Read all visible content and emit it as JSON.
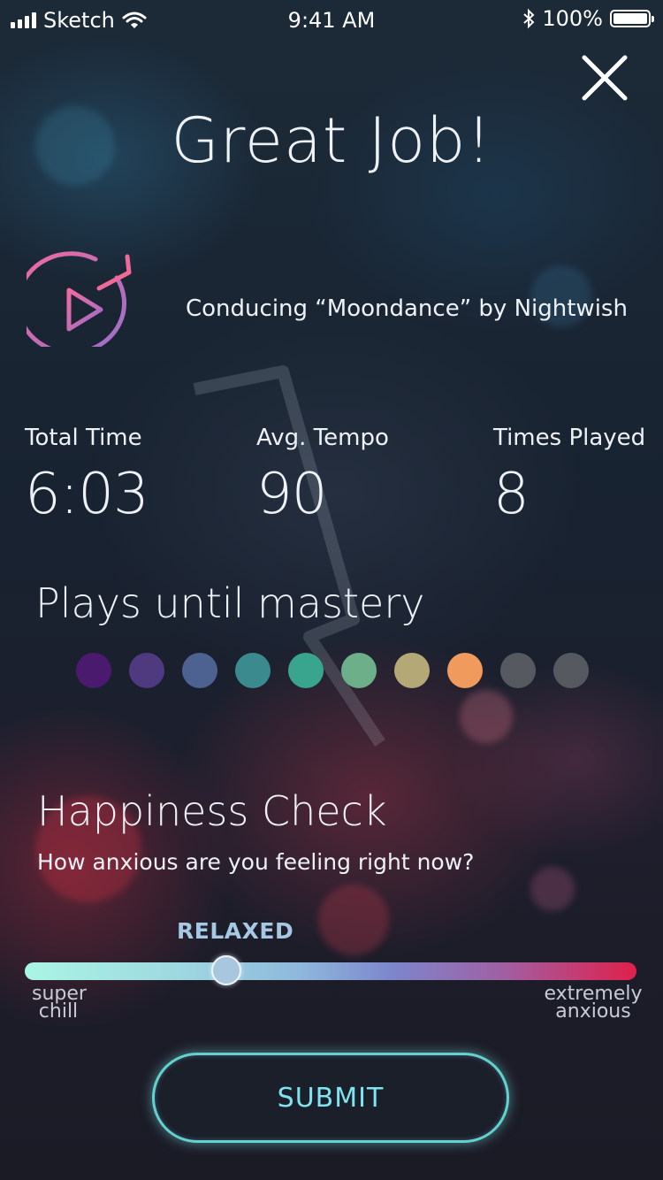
{
  "status_bar": {
    "carrier": "Sketch",
    "time": "9:41 AM",
    "battery": "100%"
  },
  "title": "Great Job!",
  "song": {
    "description": "Conducing “Moondance” by Nightwish",
    "icon": "replay-play-icon"
  },
  "stats": [
    {
      "label": "Total Time",
      "value": "6:03"
    },
    {
      "label": "Avg. Tempo",
      "value": "90"
    },
    {
      "label": "Times Played",
      "value": "8"
    }
  ],
  "mastery": {
    "title": "Plays until mastery",
    "completed": 8,
    "total": 10,
    "dot_colors": [
      "#4a1a6e",
      "#4f3a80",
      "#4d6290",
      "#3b8a8e",
      "#3aa58f",
      "#6caf88",
      "#b4a876",
      "#f09a5e",
      "#565a60",
      "#565a60"
    ]
  },
  "happiness": {
    "title": "Happiness Check",
    "question": "How anxious are you feeling right now?",
    "current_label": "RELAXED",
    "slider_value_fraction": 0.33,
    "min_label": "super chill",
    "max_label": "extremely anxious"
  },
  "submit_label": "SUBMIT",
  "colors": {
    "accent": "#7fe4f0",
    "gradient_start": "#aaf5e4",
    "gradient_end": "#e0204c"
  }
}
